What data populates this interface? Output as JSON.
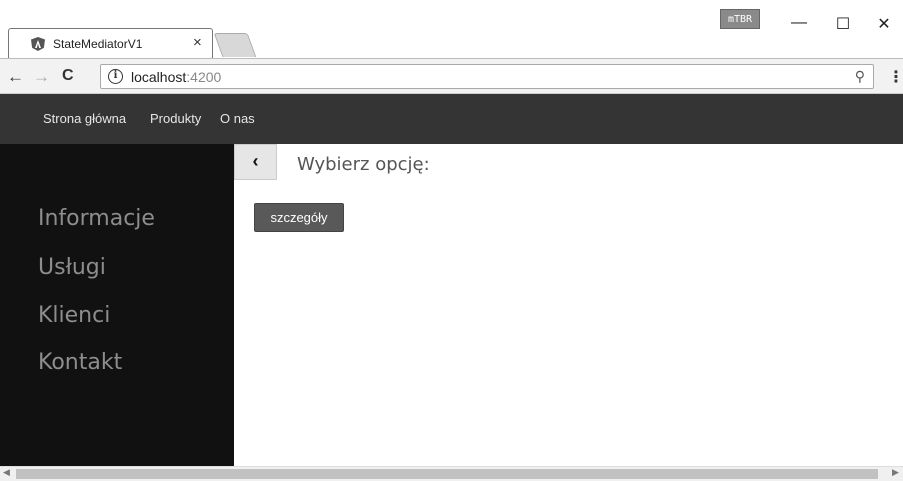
{
  "browser": {
    "tab_title": "StateMediatorV1",
    "tab_close": "×",
    "extension_badge": "mTBR",
    "window_buttons": {
      "minimize": "—",
      "maximize": "☐",
      "close": "✕"
    },
    "url_host": "localhost",
    "url_port": ":4200",
    "info_glyph": "i",
    "nav": {
      "back": "←",
      "forward": "→",
      "reload": "C"
    },
    "zoom_icon": "⚲",
    "menu_icon": "⋮"
  },
  "navbar": {
    "links": [
      "Strona główna",
      "Produkty",
      "O nas"
    ]
  },
  "sidebar": {
    "items": [
      "Informacje",
      "Usługi",
      "Klienci",
      "Kontakt"
    ]
  },
  "main": {
    "collapse_glyph": "‹",
    "prompt": "Wybierz opcję:",
    "details_button": "szczegóły"
  },
  "scrollbar": {
    "left_arrow": "◀",
    "right_arrow": "▶"
  }
}
